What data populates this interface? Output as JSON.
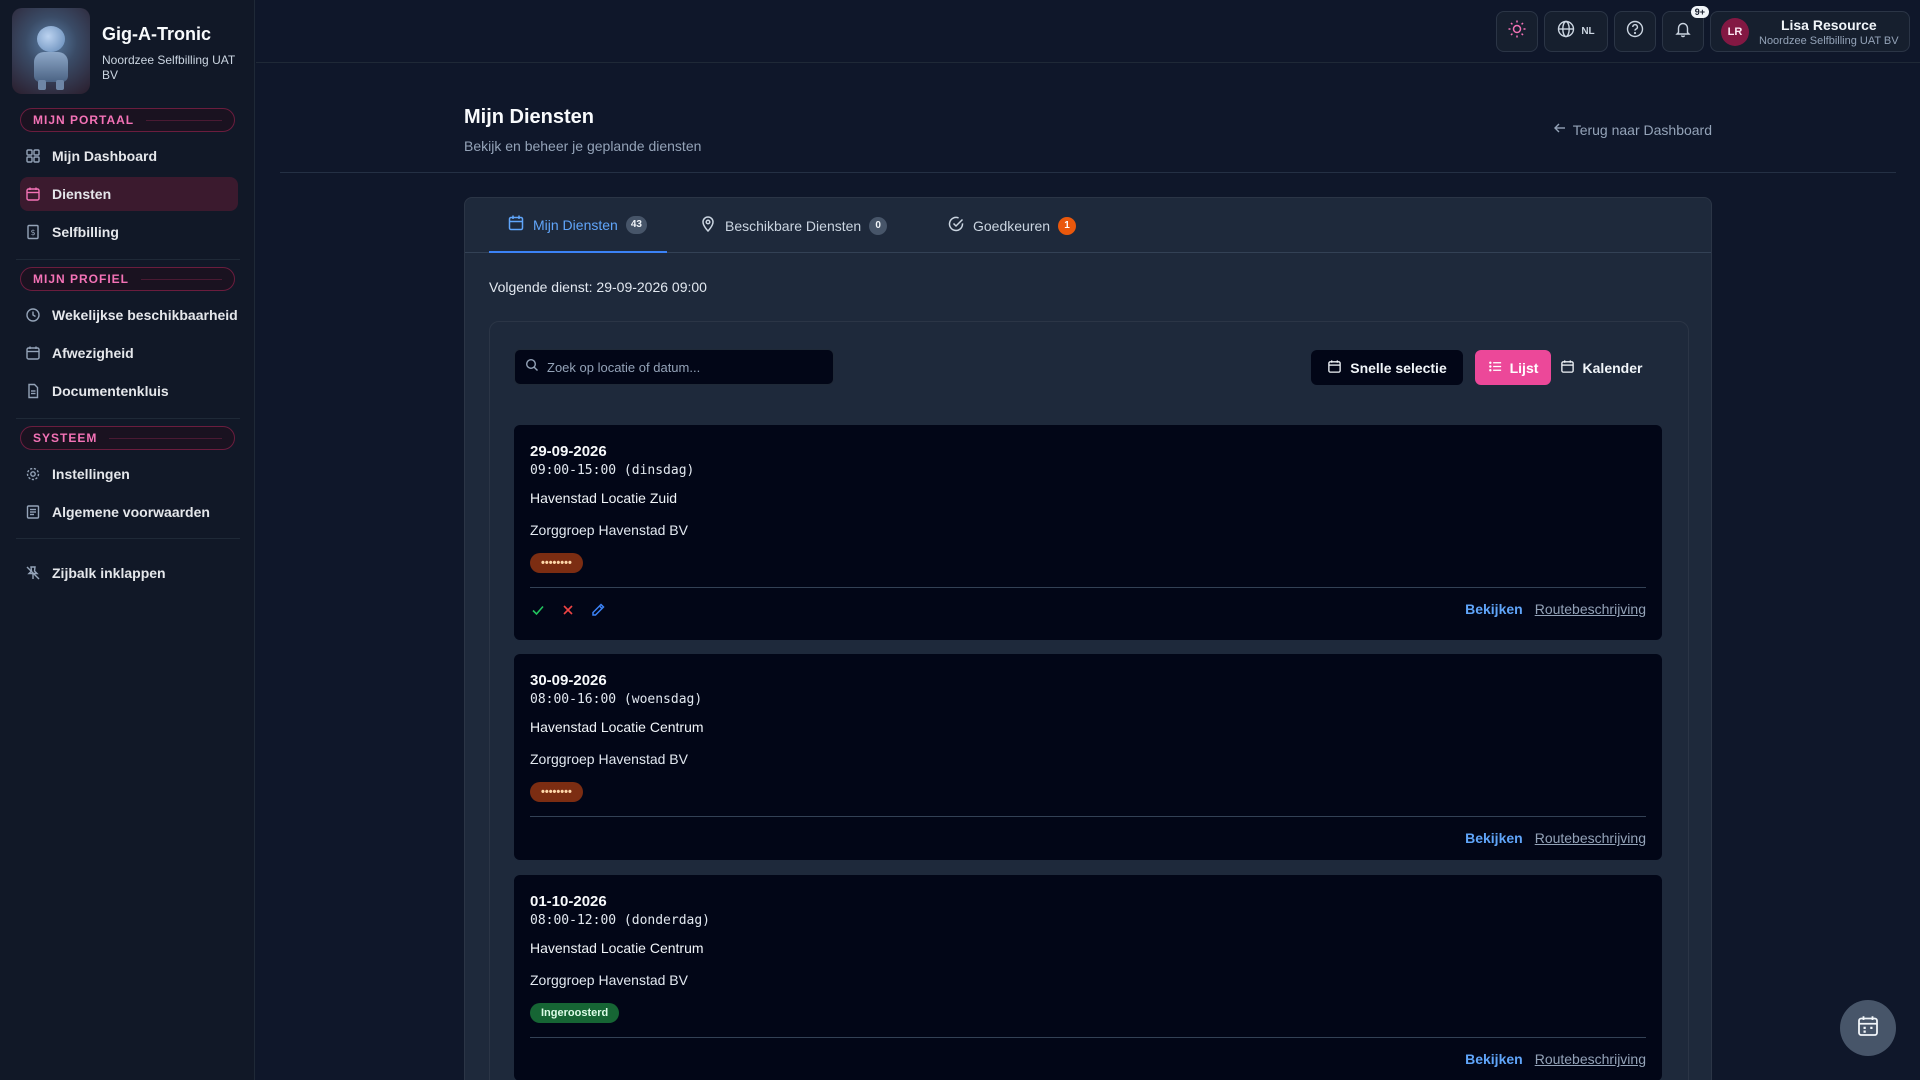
{
  "brand": {
    "name": "Gig-A-Tronic",
    "subtitle": "Noordzee Selfbilling UAT BV"
  },
  "sidebar": {
    "sections": [
      {
        "label": "MIJN PORTAAL"
      },
      {
        "label": "MIJN PROFIEL"
      },
      {
        "label": "SYSTEEM"
      }
    ],
    "items": [
      {
        "label": "Mijn Dashboard",
        "icon": "dashboard-icon"
      },
      {
        "label": "Diensten",
        "icon": "calendar-icon",
        "active": true
      },
      {
        "label": "Selfbilling",
        "icon": "receipt-icon"
      },
      {
        "label": "Wekelijkse beschikbaarheid",
        "icon": "clock-icon"
      },
      {
        "label": "Afwezigheid",
        "icon": "calendar-icon"
      },
      {
        "label": "Documentenkluis",
        "icon": "document-icon"
      },
      {
        "label": "Instellingen",
        "icon": "gear-icon"
      },
      {
        "label": "Algemene voorwaarden",
        "icon": "terms-icon"
      }
    ],
    "collapse_label": "Zijbalk inklappen"
  },
  "topbar": {
    "language": "NL",
    "notifications_badge": "9+",
    "user": {
      "initials": "LR",
      "name": "Lisa Resource",
      "org": "Noordzee Selfbilling UAT BV"
    }
  },
  "header": {
    "title": "Mijn Diensten",
    "subtitle": "Bekijk en beheer je geplande diensten",
    "back_label": "Terug naar Dashboard"
  },
  "tabs": [
    {
      "label": "Mijn Diensten",
      "count": "43",
      "active": true
    },
    {
      "label": "Beschikbare Diensten",
      "count": "0"
    },
    {
      "label": "Goedkeuren",
      "count": "1"
    }
  ],
  "next_shift": "Volgende dienst: 29-09-2026 09:00",
  "toolbar": {
    "search_placeholder": "Zoek op locatie of datum...",
    "quick_select": "Snelle selectie",
    "list": "Lijst",
    "calendar": "Kalender"
  },
  "shifts": [
    {
      "date": "29-09-2026",
      "time": "09:00-15:00 (dinsdag)",
      "location": "Havenstad Locatie Zuid",
      "org": "Zorggroep Havenstad BV",
      "status": "••••••••",
      "status_color": "#7c2d12",
      "view": "Bekijken",
      "route": "Routebeschrijving"
    },
    {
      "date": "30-09-2026",
      "time": "08:00-16:00 (woensdag)",
      "location": "Havenstad Locatie Centrum",
      "org": "Zorggroep Havenstad BV",
      "status": "••••••••",
      "status_color": "#7c2d12",
      "view": "Bekijken",
      "route": "Routebeschrijving"
    },
    {
      "date": "01-10-2026",
      "time": "08:00-12:00 (donderdag)",
      "location": "Havenstad Locatie Centrum",
      "org": "Zorggroep Havenstad BV",
      "status": "Ingeroosterd",
      "status_color": "#14532d",
      "view": "Bekijken",
      "route": "Routebeschrijving"
    }
  ],
  "colors": {
    "accent": "#ec4899",
    "link": "#60a5fa",
    "background": "#0f172a"
  }
}
